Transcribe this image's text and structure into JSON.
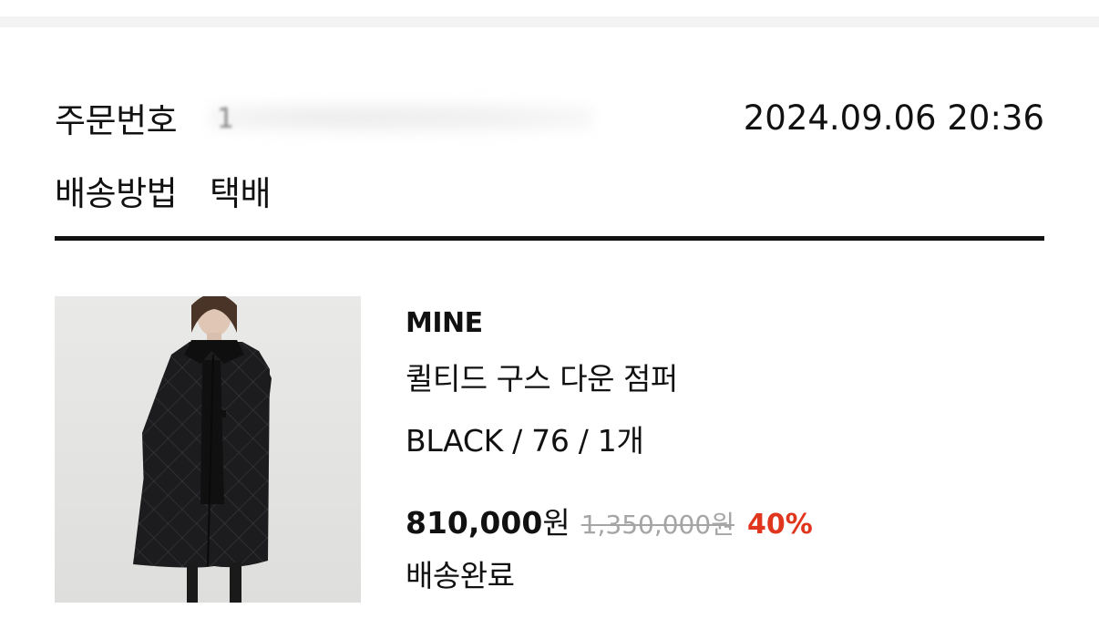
{
  "order": {
    "number_label": "주문번호",
    "number_value": "1",
    "datetime": "2024.09.06 20:36",
    "shipping_label": "배송방법",
    "shipping_value": "택배"
  },
  "product": {
    "brand": "MINE",
    "name": "퀼티드 구스 다운 점퍼",
    "options": "BLACK  /  76  /  1개",
    "price_value": "810,000",
    "price_unit": "원",
    "original_price": "1,350,000원",
    "discount": "40%",
    "status": "배송완료"
  },
  "colors": {
    "discount": "#e0361d",
    "original_price": "#a5a5a5",
    "divider": "#111111"
  }
}
